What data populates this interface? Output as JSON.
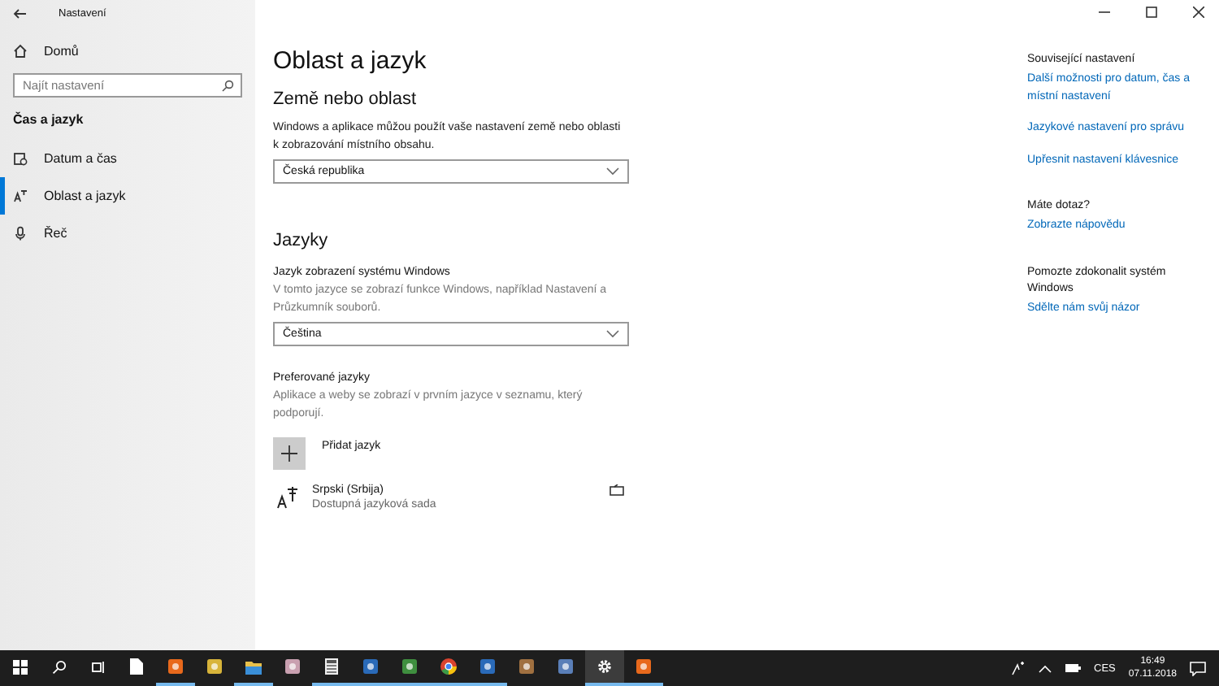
{
  "window": {
    "title": "Nastavení"
  },
  "sidebar": {
    "home": "Domů",
    "search": {
      "placeholder": "Najít nastavení"
    },
    "section": "Čas a jazyk",
    "items": [
      {
        "label": "Datum a čas",
        "kind": "calendar",
        "selected": false
      },
      {
        "label": "Oblast a jazyk",
        "kind": "language",
        "selected": true
      },
      {
        "label": "Řeč",
        "kind": "microphone",
        "selected": false
      }
    ]
  },
  "content": {
    "title": "Oblast a jazyk",
    "region": {
      "heading": "Země nebo oblast",
      "description": "Windows a aplikace můžou použít vaše nastavení země nebo oblasti k zobrazování místního obsahu.",
      "dropdown": "Česká republika"
    },
    "languages": {
      "heading": "Jazyky",
      "display_label": "Jazyk zobrazení systému Windows",
      "display_description": "V tomto jazyce se zobrazí funkce Windows, například Nastavení a Průzkumník souborů.",
      "dropdown": "Čeština",
      "preferred_label": "Preferované jazyky",
      "preferred_description": "Aplikace a weby se zobrazí v prvním jazyce v seznamu, který podporují.",
      "add_button": "Přidat jazyk",
      "items": [
        {
          "name": "Srpski (Srbija)",
          "status": "Dostupná jazyková sada"
        }
      ]
    }
  },
  "related": [
    {
      "heading": "Související nastavení",
      "links": [
        "Další možnosti pro datum, čas a místní nastavení",
        "Jazykové nastavení pro správu",
        "Upřesnit nastavení klávesnice"
      ]
    },
    {
      "heading": "Máte dotaz?",
      "links": [
        "Zobrazte nápovědu"
      ]
    },
    {
      "heading": "Pomozte zdokonalit systém Windows",
      "links": [
        "Sdělte nám svůj názor"
      ]
    }
  ],
  "taskbar": {
    "apps": [
      {
        "kind": "start",
        "running": false,
        "selected": false
      },
      {
        "kind": "search",
        "running": false,
        "selected": false
      },
      {
        "kind": "taskview",
        "running": false,
        "selected": false
      },
      {
        "kind": "document",
        "running": false,
        "selected": false
      },
      {
        "kind": "orange",
        "running": true,
        "selected": false
      },
      {
        "kind": "yellow",
        "running": false,
        "selected": false
      },
      {
        "kind": "folder",
        "running": true,
        "selected": false
      },
      {
        "kind": "pink",
        "running": false,
        "selected": false
      },
      {
        "kind": "calculator",
        "running": true,
        "selected": false
      },
      {
        "kind": "blue",
        "running": true,
        "selected": false
      },
      {
        "kind": "green",
        "running": true,
        "selected": false
      },
      {
        "kind": "chrome",
        "running": true,
        "selected": false
      },
      {
        "kind": "blue",
        "running": true,
        "selected": false
      },
      {
        "kind": "brown",
        "running": false,
        "selected": false
      },
      {
        "kind": "globe",
        "running": false,
        "selected": false
      },
      {
        "kind": "gear",
        "running": true,
        "selected": true
      },
      {
        "kind": "orange",
        "running": true,
        "selected": false
      }
    ],
    "language": "CES",
    "time": "16:49",
    "date": "07.11.2018"
  }
}
